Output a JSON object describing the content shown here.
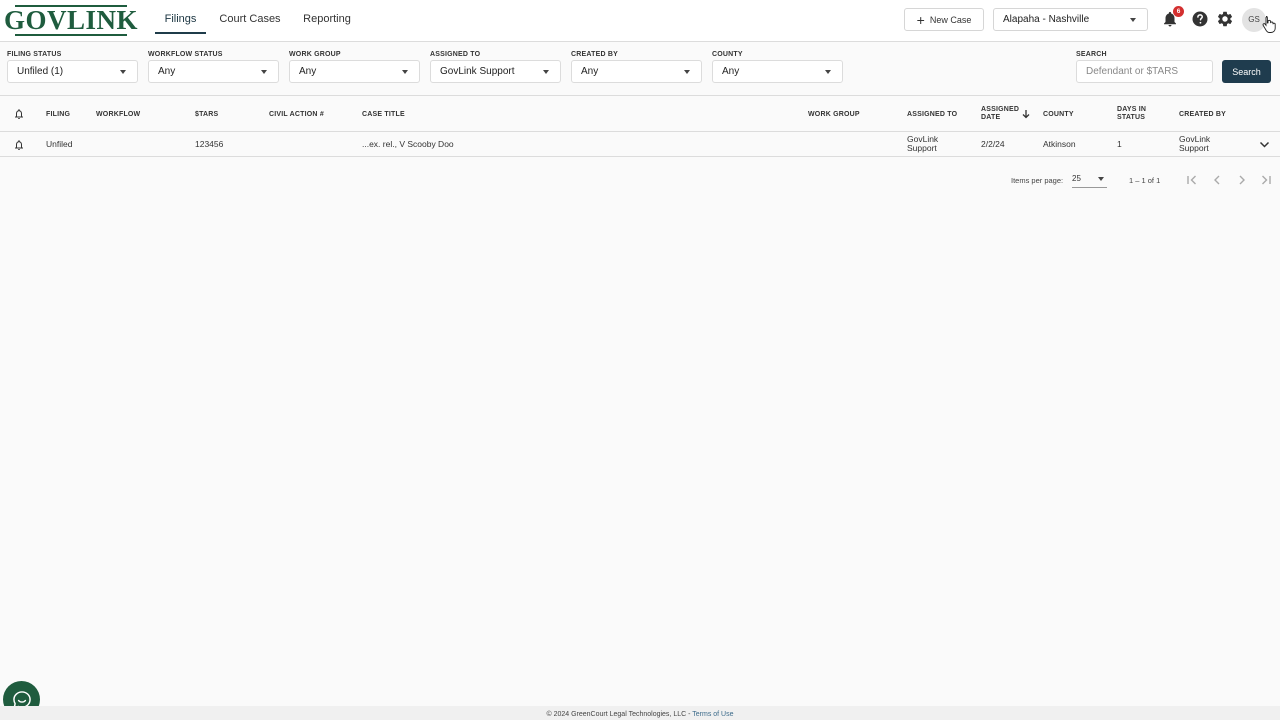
{
  "brand": {
    "logo_text": "GOVLINK"
  },
  "nav": {
    "tabs": [
      {
        "label": "Filings",
        "active": true
      },
      {
        "label": "Court Cases",
        "active": false
      },
      {
        "label": "Reporting",
        "active": false
      }
    ]
  },
  "header": {
    "new_case_label": "New Case",
    "court_selected": "Alapaha - Nashville",
    "notification_count": "6",
    "avatar_initials": "GS"
  },
  "filters": {
    "filing_status": {
      "label": "FILING STATUS",
      "value": "Unfiled (1)"
    },
    "workflow_status": {
      "label": "WORKFLOW STATUS",
      "value": "Any"
    },
    "work_group": {
      "label": "WORK GROUP",
      "value": "Any"
    },
    "assigned_to": {
      "label": "ASSIGNED TO",
      "value": "GovLink Support"
    },
    "created_by": {
      "label": "CREATED BY",
      "value": "Any"
    },
    "county": {
      "label": "COUNTY",
      "value": "Any"
    },
    "search": {
      "label": "SEARCH",
      "placeholder": "Defendant or $TARS",
      "value": ""
    },
    "search_button": "Search"
  },
  "table": {
    "columns": {
      "filing": "FILING",
      "workflow": "WORKFLOW",
      "stars": "$TARS",
      "civil_action": "CIVIL ACTION #",
      "case_title": "CASE TITLE",
      "work_group": "WORK GROUP",
      "assigned_to": "ASSIGNED TO",
      "assigned_date_1": "ASSIGNED",
      "assigned_date_2": "DATE",
      "county": "COUNTY",
      "days_in_status_1": "DAYS IN",
      "days_in_status_2": "STATUS",
      "created_by": "CREATED BY"
    },
    "sort": {
      "column": "assigned_date",
      "direction": "desc"
    },
    "rows": [
      {
        "filing": "Unfiled",
        "workflow": "",
        "stars": "123456",
        "civil_action": "",
        "case_title": "...ex. rel., V Scooby Doo",
        "work_group": "",
        "assigned_to_1": "GovLink",
        "assigned_to_2": "Support",
        "assigned_date": "2/2/24",
        "county": "Atkinson",
        "days_in_status": "1",
        "created_by_1": "GovLink",
        "created_by_2": "Support"
      }
    ]
  },
  "pagination": {
    "items_per_page_label": "Items per page:",
    "page_size": "25",
    "range": "1 – 1 of 1"
  },
  "footer": {
    "copyright": "© 2024 GreenCourt Legal Technologies, LLC - ",
    "terms_link": "Terms of Use"
  },
  "colors": {
    "brand_green": "#1f5c3e",
    "primary_navy": "#1f3c4e",
    "badge_red": "#d32f2f"
  },
  "icons": [
    "bell-icon",
    "help-icon",
    "gear-icon",
    "plus-icon",
    "chevron-down-icon",
    "sort-arrow-down-icon",
    "first-page-icon",
    "prev-page-icon",
    "next-page-icon",
    "last-page-icon",
    "chat-icon"
  ]
}
